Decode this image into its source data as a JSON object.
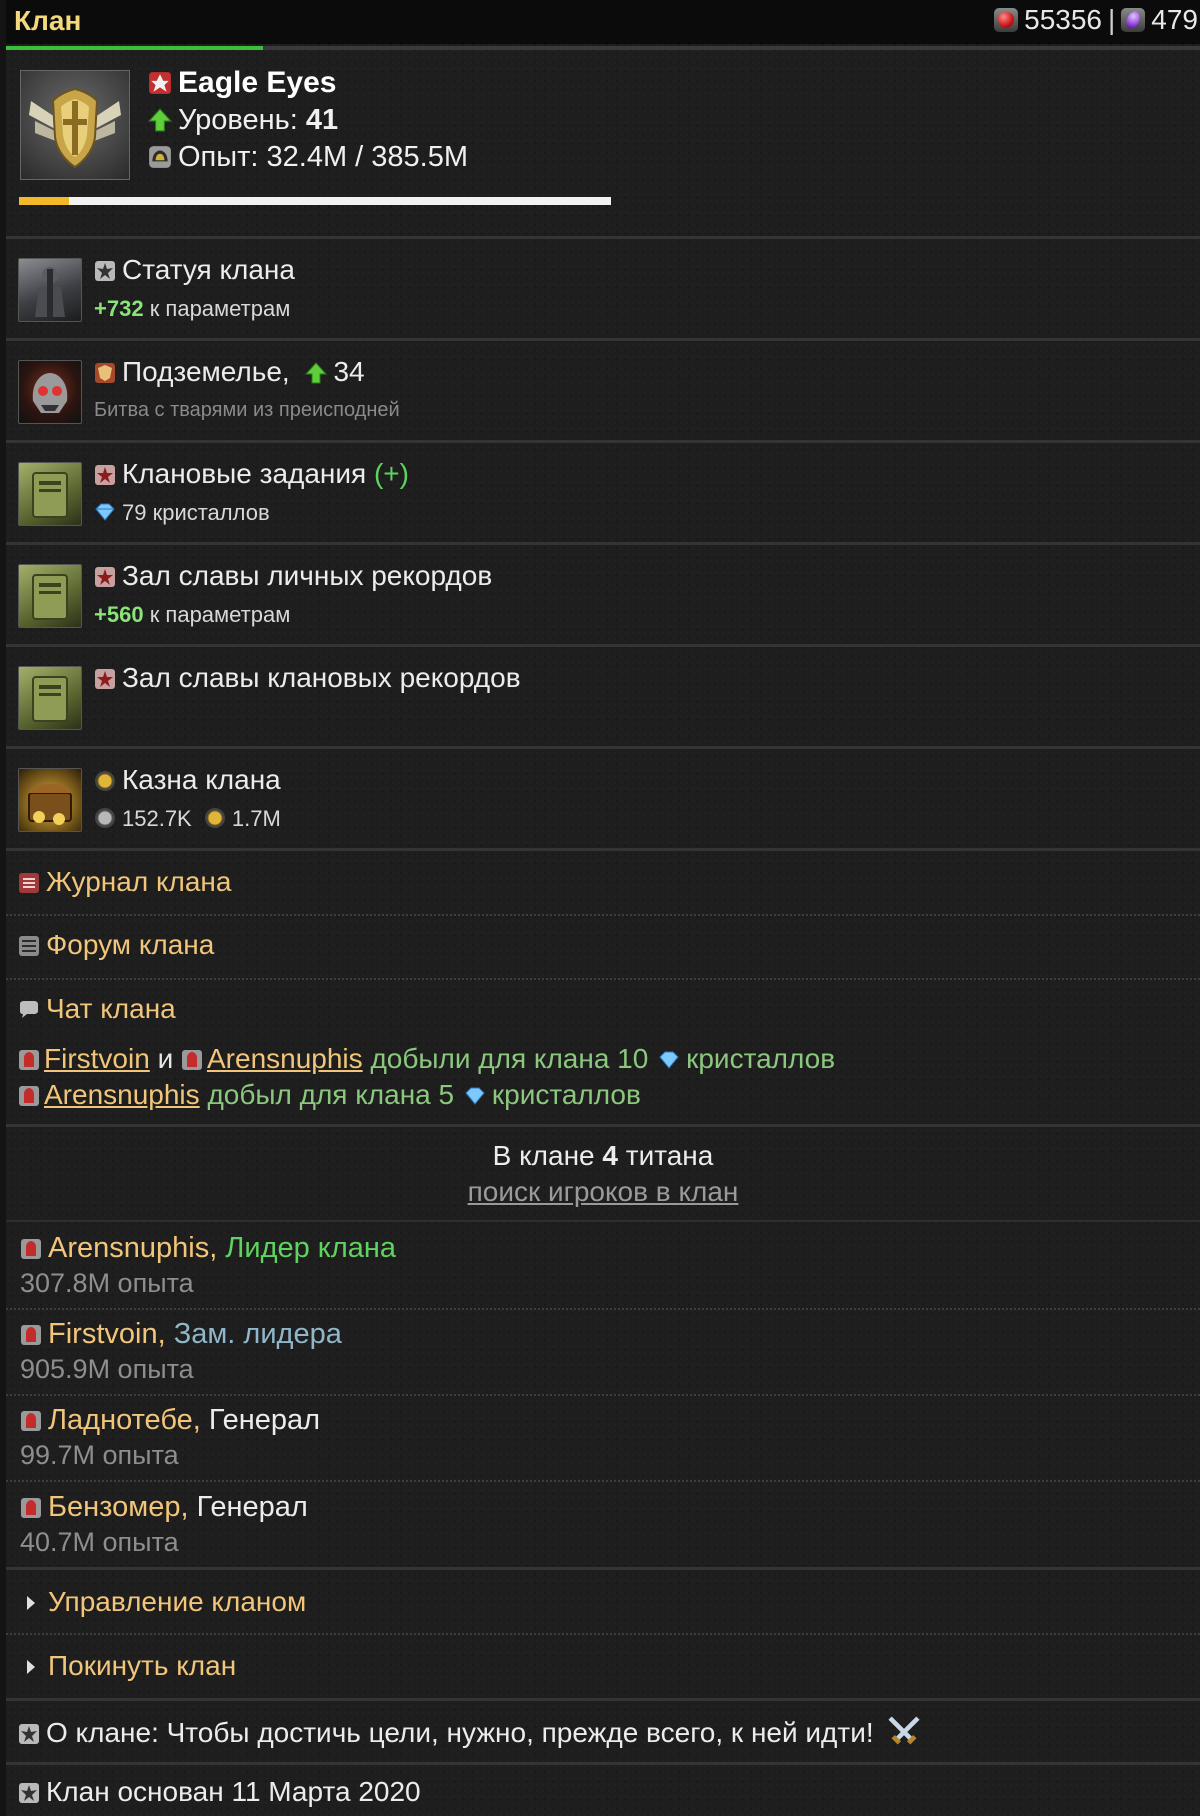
{
  "topbar": {
    "title": "Клан",
    "res_red": "55356",
    "separator": "|",
    "res_violet": "479",
    "progress_fraction": 0.215
  },
  "clan": {
    "name": "Eagle Eyes",
    "level_label": "Уровень:",
    "level_value": "41",
    "exp_text": "Опыт: 32.4M / 385.5M",
    "exp_fraction": 0.084
  },
  "menu": {
    "statue": {
      "title": "Статуя клана",
      "bonus": "+732",
      "bonus_suffix": "к параметрам"
    },
    "dungeon": {
      "title": "Подземелье,",
      "level": "34",
      "subtitle": "Битва с тварями из преисподней"
    },
    "tasks": {
      "title": "Клановые задания",
      "plus": "(+)",
      "crystals": "79 кристаллов"
    },
    "hall_personal": {
      "title": "Зал славы личных рекордов",
      "bonus": "+560",
      "bonus_suffix": "к параметрам"
    },
    "hall_clan": {
      "title": "Зал славы клановых рекордов"
    },
    "treasury": {
      "title": "Казна клана",
      "silver": "152.7K",
      "gold": "1.7M"
    },
    "journal": "Журнал клана",
    "forum": "Форум клана",
    "chat": "Чат клана"
  },
  "chat_feed": [
    {
      "user1": "Firstvoin",
      "and": "и",
      "user2": "Arensnuphis",
      "text": "добыли для клана 10",
      "suffix": "кристаллов"
    },
    {
      "user1": "Arensnuphis",
      "text": "добыл для клана 5",
      "suffix": "кристаллов"
    }
  ],
  "members_header": {
    "prefix": "В клане",
    "count": "4",
    "suffix": "титана",
    "search_link": "поиск игроков в клан"
  },
  "members": [
    {
      "name": "Arensnuphis,",
      "role": "Лидер клана",
      "exp": "307.8M опыта",
      "role_color": "#5fd35f"
    },
    {
      "name": "Firstvoin,",
      "role": "Зам. лидера",
      "exp": "905.9M опыта",
      "role_color": "#8fb7c9"
    },
    {
      "name": "Ладнотебе,",
      "role": "Генерал",
      "exp": "99.7M опыта",
      "role_color": "#ececec"
    },
    {
      "name": "Бензомер,",
      "role": "Генерал",
      "exp": "40.7M опыта",
      "role_color": "#ececec"
    }
  ],
  "actions": {
    "manage": "Управление кланом",
    "leave": "Покинуть клан"
  },
  "footer": {
    "about": "О клане: Чтобы достичь цели, нужно, прежде всего, к ней идти!",
    "founded": "Клан основан 11 Марта 2020"
  },
  "colors": {
    "accent_gold": "#f1c57a",
    "title_yellow": "#f3d97c",
    "bonus_green": "#8be37a",
    "chat_green": "#8cc77e",
    "progress_green": "#3bbf3b",
    "exp_yellow": "#f2b928"
  },
  "icons": [
    "red-gem-icon",
    "violet-gem-icon",
    "clan-flag-icon",
    "level-up-arrow-icon",
    "helmet-icon",
    "statue-icon",
    "dungeon-icon",
    "task-icon",
    "crystal-icon",
    "coin-icon",
    "journal-icon",
    "forum-icon",
    "chat-icon",
    "titan-icon",
    "chevron-right-icon",
    "crossed-swords-icon"
  ]
}
